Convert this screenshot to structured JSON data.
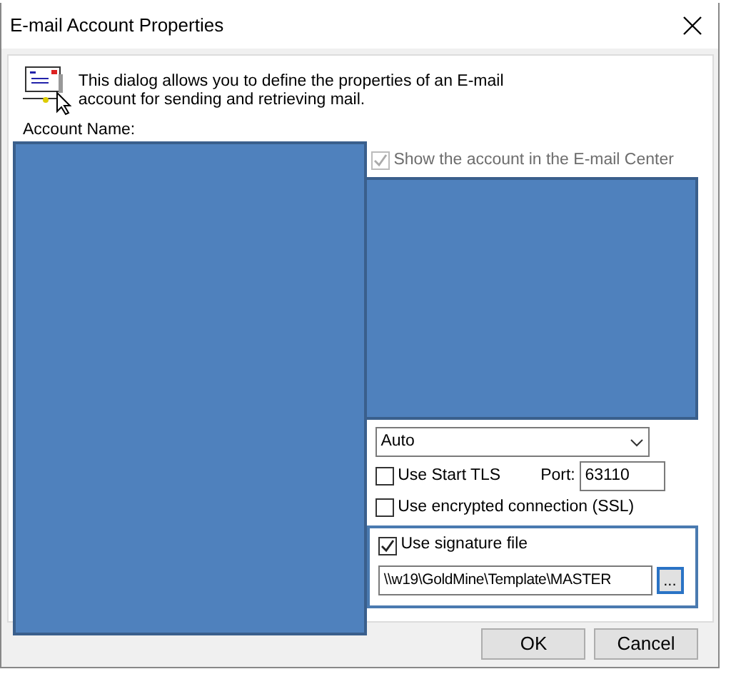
{
  "window": {
    "title": "E-mail Account Properties"
  },
  "intro": "This dialog allows you to define the properties of an E-mail account for sending and retrieving mail.",
  "account_name_label": "Account Name:",
  "show_in_center": {
    "label": "Show the account in the E-mail Center",
    "checked": true,
    "disabled": true
  },
  "security_dropdown": {
    "value": "Auto"
  },
  "start_tls": {
    "label": "Use Start TLS",
    "checked": false
  },
  "port": {
    "label": "Port:",
    "value": "63110"
  },
  "ssl": {
    "label": "Use encrypted connection (SSL)",
    "checked": false
  },
  "signature": {
    "label": "Use signature file",
    "checked": true,
    "path": "\\\\w19\\GoldMine\\Template\\MASTER",
    "browse_label": "..."
  },
  "buttons": [
    {
      "label": "OK"
    },
    {
      "label": "Cancel"
    }
  ]
}
